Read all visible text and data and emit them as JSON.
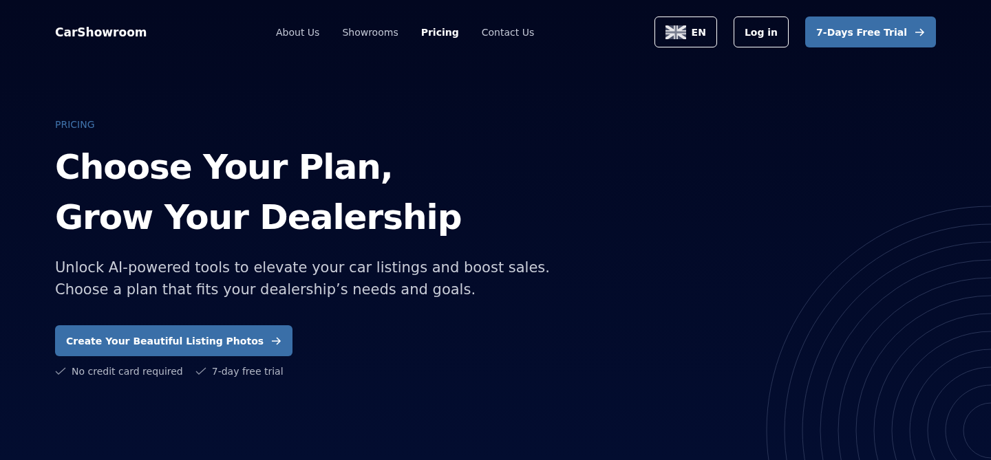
{
  "header": {
    "logo": "CarShowroom",
    "nav": [
      {
        "label": "About Us",
        "selected": false
      },
      {
        "label": "Showrooms",
        "selected": false
      },
      {
        "label": "Pricing",
        "selected": true
      },
      {
        "label": "Contact Us",
        "selected": false
      }
    ],
    "language": "EN",
    "login": "Log in",
    "trial": "7-Days Free Trial"
  },
  "hero": {
    "eyebrow": "PRICING",
    "title_lines": [
      "Choose Your Plan,",
      "Grow Your Dealership"
    ],
    "subtitle": "Unlock AI-powered tools to elevate your car listings and boost sales. Choose a plan that fits your dealership’s needs and goals.",
    "cta": "Create Your Beautiful Listing Photos",
    "perks": [
      "No credit card required",
      "7-day free trial"
    ]
  }
}
